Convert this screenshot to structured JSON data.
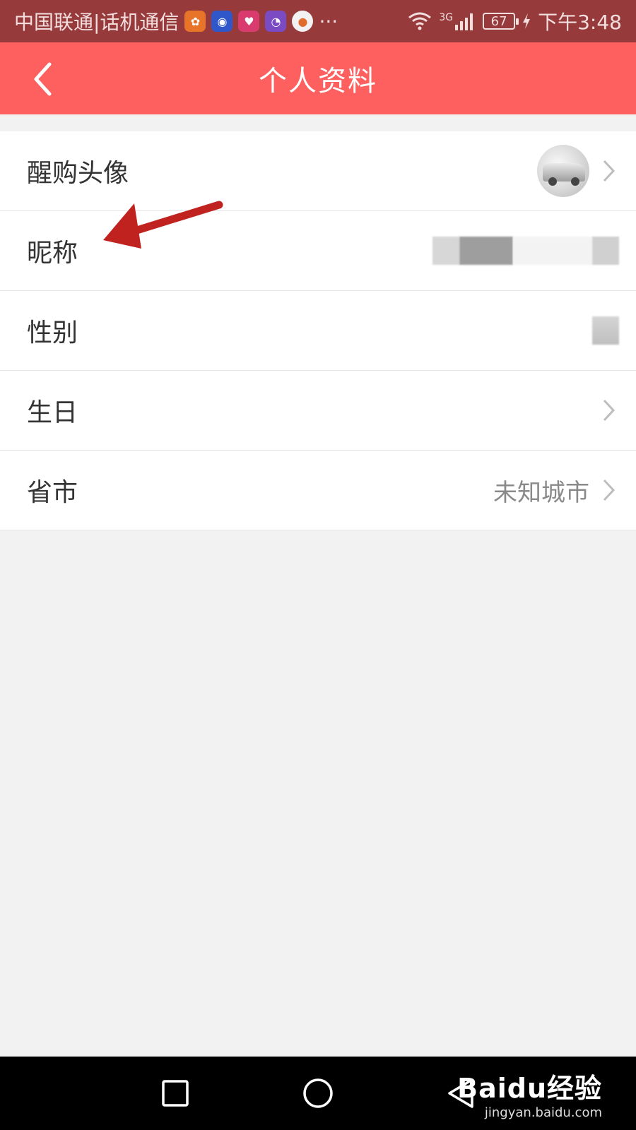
{
  "status_bar": {
    "carrier": "中国联通|话机通信",
    "more": "···",
    "signal_type": "3G",
    "battery": "67",
    "time": "下午3:48"
  },
  "header": {
    "title": "个人资料"
  },
  "profile_rows": [
    {
      "label": "醒购头像"
    },
    {
      "label": "昵称"
    },
    {
      "label": "性别"
    },
    {
      "label": "生日"
    },
    {
      "label": "省市",
      "value": "未知城市"
    }
  ],
  "colors": {
    "status_bar": "#963a3c",
    "header": "#fe5f5f",
    "annotation_arrow": "#c0231f"
  },
  "watermark": {
    "logo": "Baidu经验",
    "url": "jingyan.baidu.com"
  }
}
